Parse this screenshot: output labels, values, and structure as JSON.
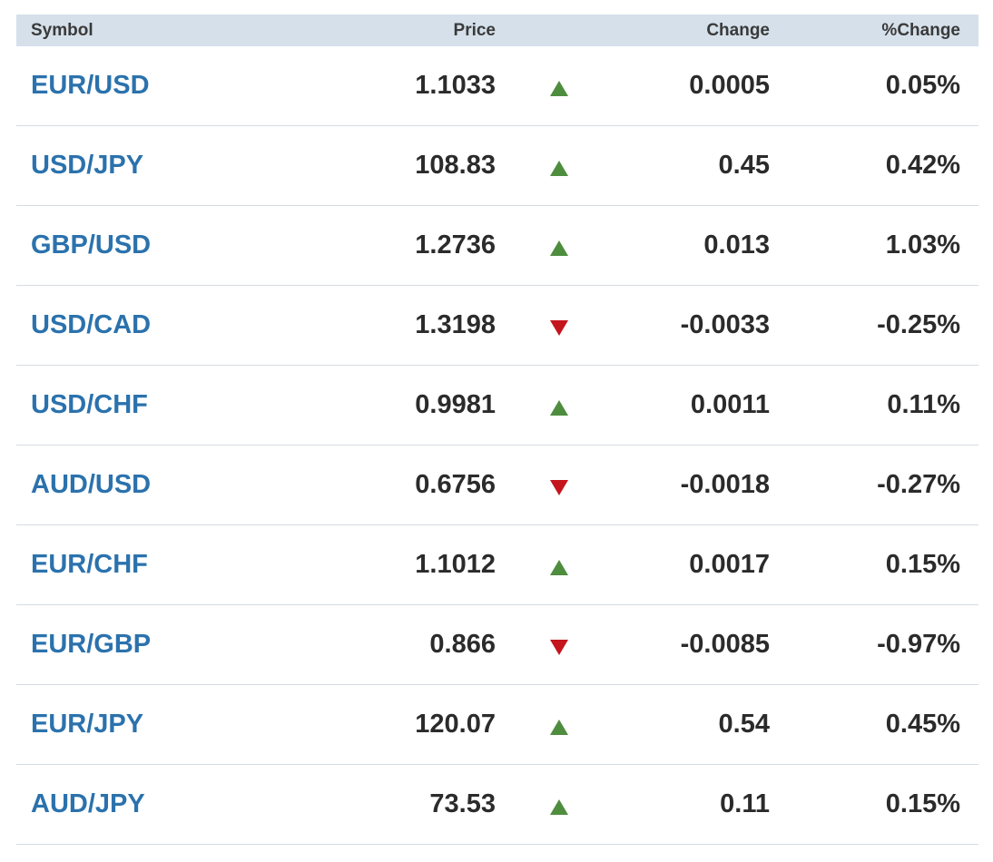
{
  "colors": {
    "header_bg": "#d5e0ea",
    "symbol_link": "#2b72ad",
    "up_arrow": "#4e8d3d",
    "down_arrow": "#c4151c",
    "divider": "#d4dbe2"
  },
  "header": {
    "symbol": "Symbol",
    "price": "Price",
    "change": "Change",
    "pct_change": "%Change"
  },
  "rows": [
    {
      "symbol": "EUR/USD",
      "price": "1.1033",
      "direction": "up",
      "icon": "triangle-up-icon",
      "change": "0.0005",
      "pct_change": "0.05%"
    },
    {
      "symbol": "USD/JPY",
      "price": "108.83",
      "direction": "up",
      "icon": "triangle-up-icon",
      "change": "0.45",
      "pct_change": "0.42%"
    },
    {
      "symbol": "GBP/USD",
      "price": "1.2736",
      "direction": "up",
      "icon": "triangle-up-icon",
      "change": "0.013",
      "pct_change": "1.03%"
    },
    {
      "symbol": "USD/CAD",
      "price": "1.3198",
      "direction": "down",
      "icon": "triangle-down-icon",
      "change": "-0.0033",
      "pct_change": "-0.25%"
    },
    {
      "symbol": "USD/CHF",
      "price": "0.9981",
      "direction": "up",
      "icon": "triangle-up-icon",
      "change": "0.0011",
      "pct_change": "0.11%"
    },
    {
      "symbol": "AUD/USD",
      "price": "0.6756",
      "direction": "down",
      "icon": "triangle-down-icon",
      "change": "-0.0018",
      "pct_change": "-0.27%"
    },
    {
      "symbol": "EUR/CHF",
      "price": "1.1012",
      "direction": "up",
      "icon": "triangle-up-icon",
      "change": "0.0017",
      "pct_change": "0.15%"
    },
    {
      "symbol": "EUR/GBP",
      "price": "0.866",
      "direction": "down",
      "icon": "triangle-down-icon",
      "change": "-0.0085",
      "pct_change": "-0.97%"
    },
    {
      "symbol": "EUR/JPY",
      "price": "120.07",
      "direction": "up",
      "icon": "triangle-up-icon",
      "change": "0.54",
      "pct_change": "0.45%"
    },
    {
      "symbol": "AUD/JPY",
      "price": "73.53",
      "direction": "up",
      "icon": "triangle-up-icon",
      "change": "0.11",
      "pct_change": "0.15%"
    }
  ]
}
